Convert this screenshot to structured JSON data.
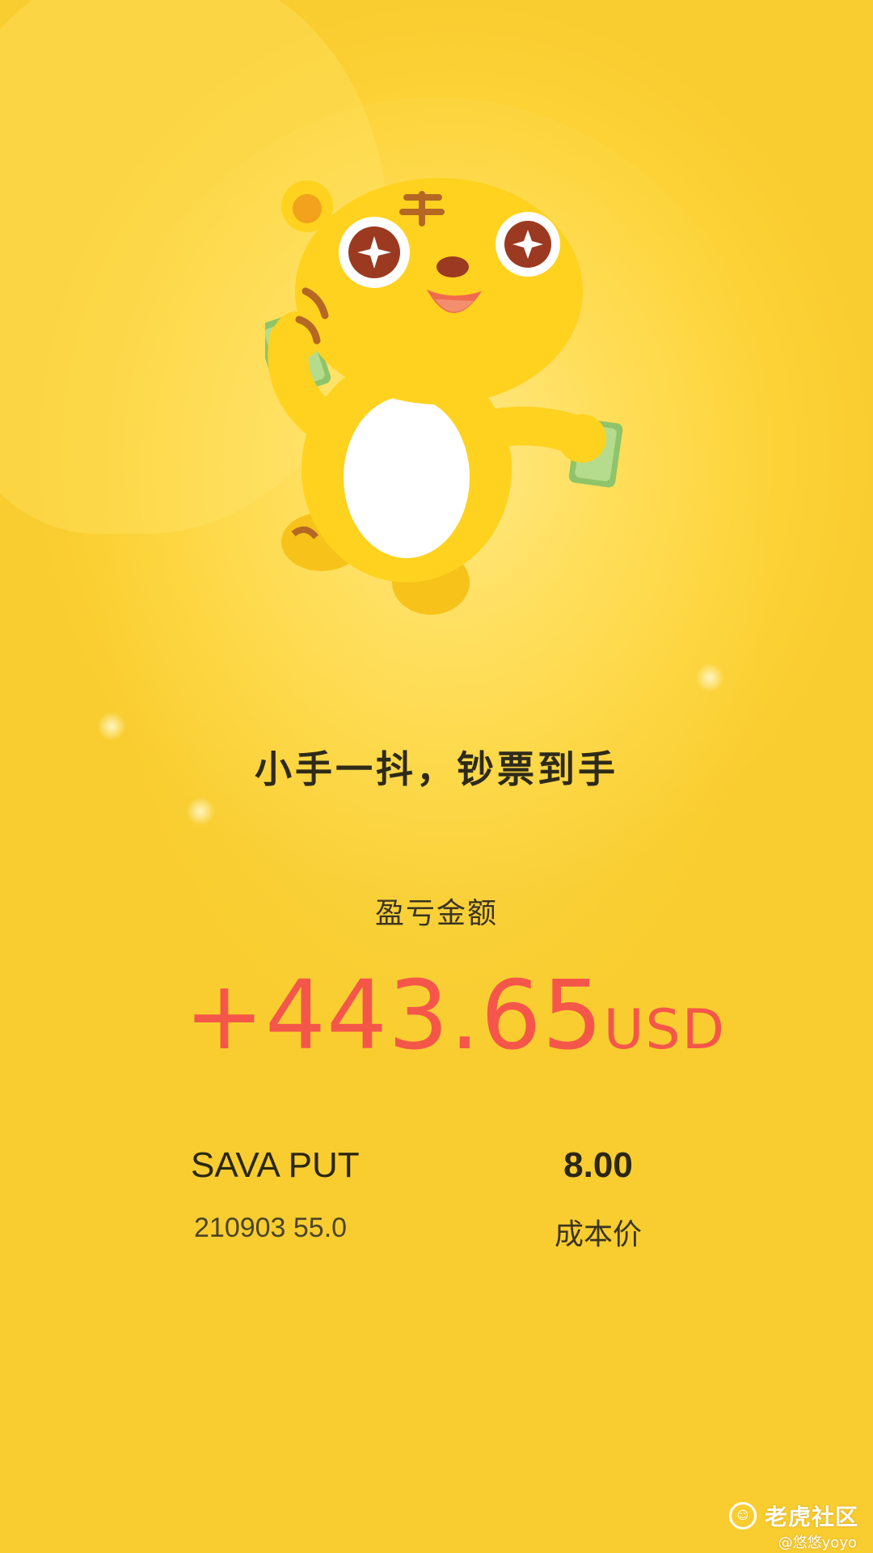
{
  "headline": "小手一抖，钞票到手",
  "pnl": {
    "label": "盈亏金额",
    "value": "+443.65",
    "unit": "USD"
  },
  "contract": {
    "name": "SAVA PUT",
    "detail": "210903 55.0"
  },
  "cost": {
    "value": "8.00",
    "label": "成本价"
  },
  "watermark": {
    "brand": "老虎社区",
    "user": "@悠悠yoyo"
  },
  "colors": {
    "background": "#fdd43a",
    "profit": "#f4574a",
    "text_dark": "#2e2a1a"
  },
  "icons": {
    "mascot": "tiger-mascot-with-cash",
    "watermark_logo": "tiger-community-logo"
  }
}
